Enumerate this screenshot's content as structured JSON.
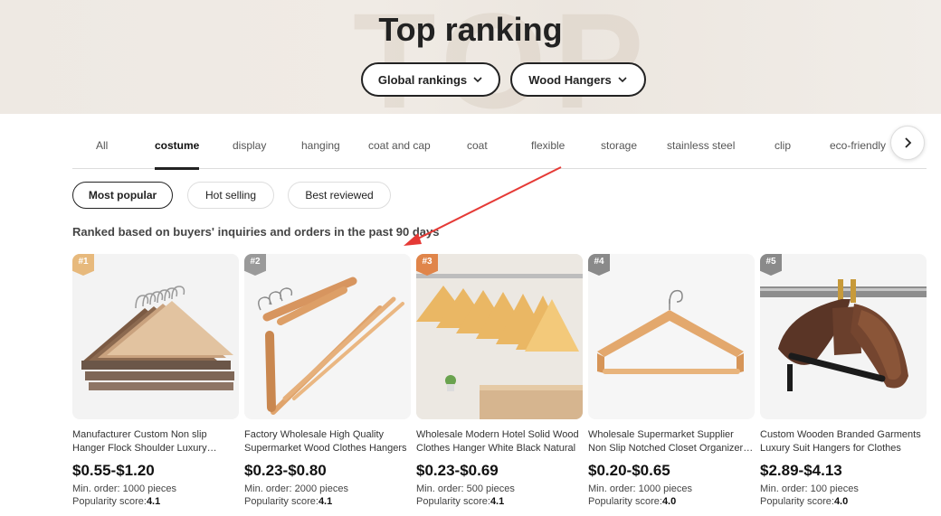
{
  "hero": {
    "title": "Top ranking",
    "watermark": "TOP",
    "global_rankings_label": "Global rankings",
    "category_label": "Wood Hangers"
  },
  "tabs": [
    {
      "label": "All",
      "active": false
    },
    {
      "label": "costume",
      "active": true
    },
    {
      "label": "display",
      "active": false
    },
    {
      "label": "hanging",
      "active": false
    },
    {
      "label": "coat and cap",
      "active": false
    },
    {
      "label": "coat",
      "active": false
    },
    {
      "label": "flexible",
      "active": false
    },
    {
      "label": "storage",
      "active": false
    },
    {
      "label": "stainless steel",
      "active": false
    },
    {
      "label": "clip",
      "active": false
    },
    {
      "label": "eco-friendly",
      "active": false
    }
  ],
  "filters": [
    {
      "label": "Most popular",
      "active": true
    },
    {
      "label": "Hot selling",
      "active": false
    },
    {
      "label": "Best reviewed",
      "active": false
    }
  ],
  "subtitle": "Ranked based on buyers' inquiries and orders in the past 90 days",
  "products": [
    {
      "rank": "#1",
      "badge_color": "#e7b97c",
      "title": "Manufacturer Custom Non slip Hanger Flock Shoulder Luxury Wooden Hangers",
      "price": "$0.55-$1.20",
      "min_order": "Min. order: 1000 pieces",
      "popularity_label": "Popularity score:",
      "popularity": "4.1"
    },
    {
      "rank": "#2",
      "badge_color": "#9a9a9a",
      "title": "Factory Wholesale High Quality Supermarket Wood Clothes Hangers",
      "price": "$0.23-$0.80",
      "min_order": "Min. order: 2000 pieces",
      "popularity_label": "Popularity score:",
      "popularity": "4.1"
    },
    {
      "rank": "#3",
      "badge_color": "#e0854a",
      "title": "Wholesale Modern Hotel Solid Wood Clothes Hanger White Black Natural",
      "price": "$0.23-$0.69",
      "min_order": "Min. order: 500 pieces",
      "popularity_label": "Popularity score:",
      "popularity": "4.1"
    },
    {
      "rank": "#4",
      "badge_color": "#8a8a8a",
      "title": "Wholesale Supermarket Supplier Non Slip Notched Closet Organizer Hangers",
      "price": "$0.20-$0.65",
      "min_order": "Min. order: 1000 pieces",
      "popularity_label": "Popularity score:",
      "popularity": "4.0"
    },
    {
      "rank": "#5",
      "badge_color": "#8a8a8a",
      "title": "Custom Wooden Branded Garments Luxury Suit Hangers for Clothes",
      "price": "$2.89-$4.13",
      "min_order": "Min. order: 100 pieces",
      "popularity_label": "Popularity score:",
      "popularity": "4.0"
    }
  ],
  "icons": {
    "dropdown": "chevron-down-icon",
    "next": "chevron-right-icon"
  },
  "colors": {
    "annotation_arrow": "#e53935"
  }
}
